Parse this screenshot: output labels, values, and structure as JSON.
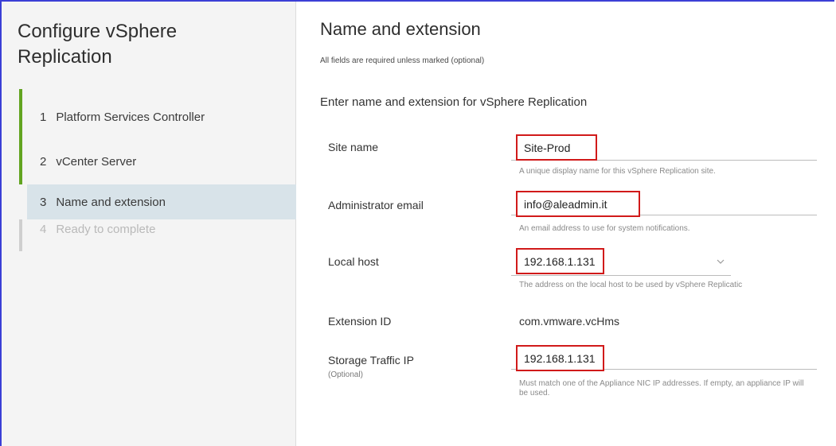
{
  "wizard": {
    "title": "Configure vSphere Replication",
    "steps": [
      {
        "number": "1",
        "label": "Platform Services Controller",
        "state": "done"
      },
      {
        "number": "2",
        "label": "vCenter Server",
        "state": "done"
      },
      {
        "number": "3",
        "label": "Name and extension",
        "state": "active"
      },
      {
        "number": "4",
        "label": "Ready to complete",
        "state": "disabled"
      }
    ]
  },
  "main": {
    "title": "Name and extension",
    "required_note": "All fields are required unless marked (optional)",
    "section_title": "Enter name and extension for vSphere Replication",
    "fields": {
      "site_name": {
        "label": "Site name",
        "value": "Site-Prod",
        "hint": "A unique display name for this vSphere Replication site."
      },
      "admin_email": {
        "label": "Administrator email",
        "value": "info@aleadmin.it",
        "hint": "An email address to use for system notifications."
      },
      "local_host": {
        "label": "Local host",
        "value": "192.168.1.131",
        "hint": "The address on the local host to be used by vSphere Replicatic"
      },
      "extension_id": {
        "label": "Extension ID",
        "value": "com.vmware.vcHms"
      },
      "storage_traffic_ip": {
        "label": "Storage Traffic IP",
        "sublabel": "(Optional)",
        "value": "192.168.1.131",
        "hint": "Must match one of the Appliance NIC IP addresses. If empty, an appliance IP will be used."
      }
    }
  },
  "colors": {
    "accent_done": "#62a420",
    "active_step_bg": "#d8e3e9",
    "highlight": "#d11a1a",
    "window_border": "#3b3fd6"
  },
  "icons": {
    "dropdown": "chevron-down-icon"
  }
}
